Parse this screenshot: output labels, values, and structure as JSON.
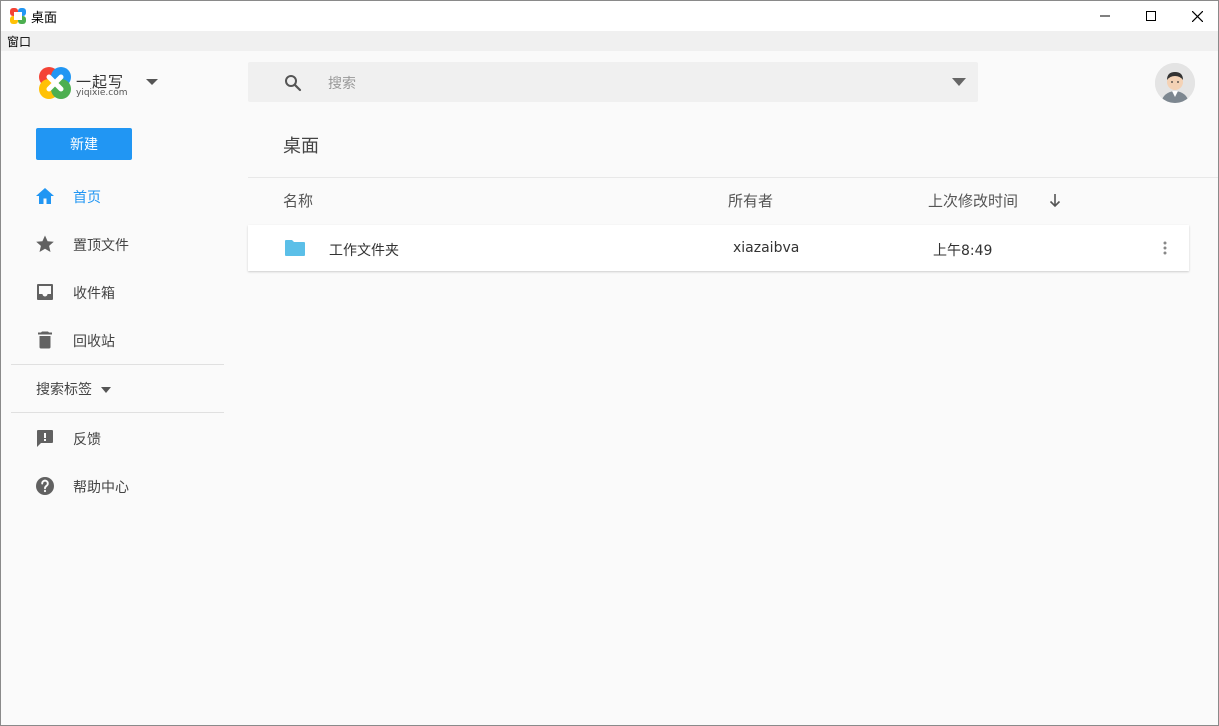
{
  "window": {
    "title": "桌面"
  },
  "menubar": {
    "items": [
      "窗口"
    ]
  },
  "brand": {
    "name": "一起写",
    "domain": "yiqixie.com"
  },
  "sidebar": {
    "new_label": "新建",
    "items": [
      {
        "label": "首页",
        "icon": "home-icon",
        "active": true
      },
      {
        "label": "置顶文件",
        "icon": "star-icon"
      },
      {
        "label": "收件箱",
        "icon": "inbox-icon"
      },
      {
        "label": "回收站",
        "icon": "trash-icon"
      }
    ],
    "tags_label": "搜索标签",
    "footer_items": [
      {
        "label": "反馈",
        "icon": "feedback-icon"
      },
      {
        "label": "帮助中心",
        "icon": "help-icon"
      }
    ]
  },
  "search": {
    "placeholder": "搜索",
    "value": ""
  },
  "main": {
    "title": "桌面",
    "columns": {
      "name": "名称",
      "owner": "所有者",
      "modified": "上次修改时间"
    },
    "rows": [
      {
        "name": "工作文件夹",
        "owner": "xiazaibva",
        "modified": "上午8:49",
        "type": "folder"
      }
    ]
  },
  "colors": {
    "accent": "#2196f3",
    "folder": "#5bbfe8"
  }
}
